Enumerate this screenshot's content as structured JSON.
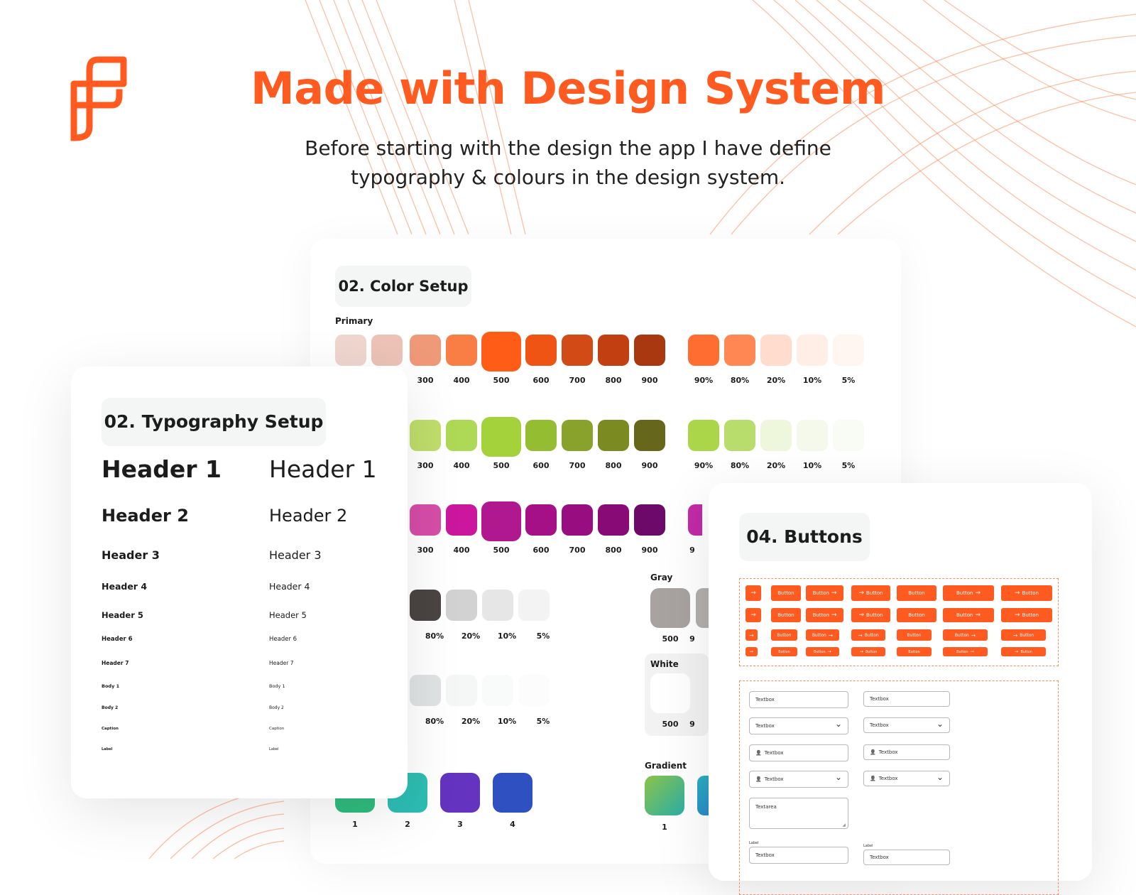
{
  "hero": {
    "title": "Made with Design System",
    "subtitle_line1": "Before starting with the design the app I have define",
    "subtitle_line2": "typography & colours in the design system.",
    "brand_color": "#ff5a1f"
  },
  "color_setup": {
    "title": "02. Color Setup",
    "primary_label": "Primary",
    "gray_label": "Gray",
    "white_label": "White",
    "gradient_label": "Gradient",
    "shade_labels": [
      "300",
      "400",
      "500",
      "600",
      "700",
      "800",
      "900"
    ],
    "opacity_labels": [
      "90%",
      "80%",
      "20%",
      "10%",
      "5%"
    ],
    "partial_opacity_labels": [
      "80%",
      "20%",
      "10%",
      "5%"
    ],
    "gray_value": "500",
    "white_value": "500",
    "gradient_value": "1",
    "side_partial": "9",
    "accent_labels": [
      "1",
      "2",
      "3",
      "4"
    ],
    "primary_colors": [
      "#efd7d0",
      "#ecc3b6",
      "#f09978",
      "#f97e45",
      "#ff5d17",
      "#ef5414",
      "#d24a15",
      "#c23f12",
      "#a93810"
    ],
    "primary_opacity_colors": [
      "#ff6d31",
      "#ff8753",
      "#ffdccd",
      "#ffeee6",
      "#fff6f2"
    ],
    "green_colors": [
      "#bfde6b",
      "#aed957",
      "#a3d23b",
      "#94bd32",
      "#88a22b",
      "#7b8b22",
      "#66671b"
    ],
    "green_opacity_colors": [
      "#acd64a",
      "#b9dd6d",
      "#eef6dc",
      "#f5f9ec",
      "#f9fcf4"
    ],
    "magenta_colors": [
      "#d64da8",
      "#cb179e",
      "#b01890",
      "#a51086",
      "#980d80",
      "#880a77",
      "#6d0969"
    ],
    "gray_row_colors": [
      "#4a4443",
      "#d3d2d2",
      "#e7e6e6",
      "#f3f3f3"
    ],
    "light_row_colors": [
      "#dfe3e3",
      "#f5f6f6",
      "#f9fafa",
      "#fcfcfc"
    ],
    "accent_colors": [
      "#2fbc7e",
      "#2dbdb3",
      "#6434c0",
      "#2f50c0"
    ],
    "gray_swatch": "#a8a3a1"
  },
  "typography": {
    "title": "02. Typography Setup",
    "styles": [
      "Header 1",
      "Header 2",
      "Header 3",
      "Header 4",
      "Header 5",
      "Header 6",
      "Header 7",
      "Body 1",
      "Body 2",
      "Caption",
      "Label"
    ]
  },
  "buttons": {
    "title": "04. Buttons",
    "button_label": "Button",
    "textbox_label": "Textbox",
    "textarea_label": "Textarea",
    "field_label": "Label"
  }
}
